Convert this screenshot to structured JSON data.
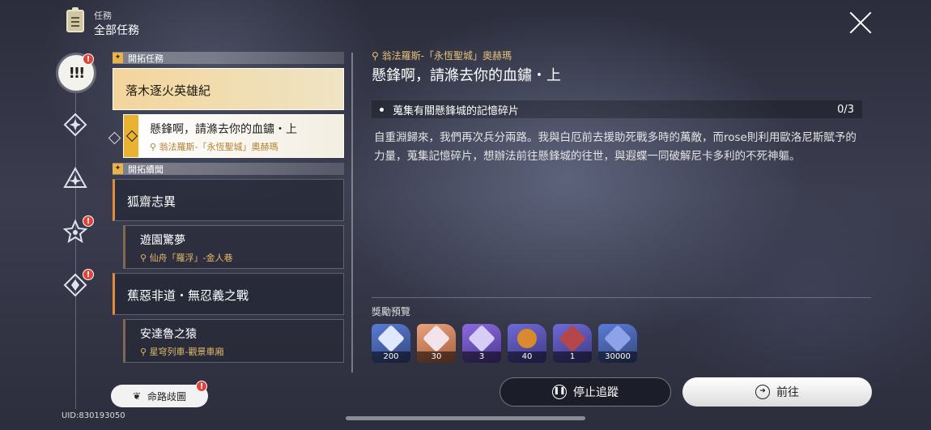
{
  "header": {
    "subtitle": "任務",
    "title": "全部任務"
  },
  "sections": [
    {
      "label": "開拓任務"
    },
    {
      "label": "開拓續聞"
    }
  ],
  "quests": {
    "q1": {
      "title": "落木逐火英雄紀"
    },
    "q1s": {
      "title": "懸鋒啊，請滌去你的血鏽・上",
      "location": "翁法羅斯-「永恆聖城」奧赫瑪"
    },
    "q2": {
      "title": "狐齋志異"
    },
    "q2s": {
      "title": "遊園驚夢",
      "location": "仙舟「羅浮」-金人巷"
    },
    "q3": {
      "title": "蕉惡非道・無忍義之戰"
    },
    "q3s": {
      "title": "安達魯之猿",
      "location": "星穹列車-觀景車廂"
    }
  },
  "detail": {
    "location": "翁法羅斯-「永恆聖城」奧赫瑪",
    "title": "懸鋒啊，請滌去你的血鏽・上",
    "objective": "蒐集有關懸鋒城的記憶碎片",
    "progress": "0/3",
    "description": "自重淵歸來，我們再次兵分兩路。我與白厄前去援助死戰多時的萬敵，而rose則利用歐洛尼斯賦予的力量，蒐集記憶碎片，想辦法前往懸鋒城的往世，與遐蝶一同破解尼卡多利的不死神軀。"
  },
  "rewards": {
    "label": "獎勵預覽",
    "items": [
      {
        "qty": "200",
        "icon": "stellar-jade-icon",
        "color": "#5a7bd6"
      },
      {
        "qty": "30",
        "icon": "crystal-icon",
        "color": "#e08a60"
      },
      {
        "qty": "3",
        "icon": "purple-material-icon",
        "color": "#7a5ad8"
      },
      {
        "qty": "40",
        "icon": "bottle-icon",
        "color": "#6a66d0"
      },
      {
        "qty": "1",
        "icon": "book-icon",
        "color": "#6a66d0"
      },
      {
        "qty": "30000",
        "icon": "credit-icon",
        "color": "#5a7bd6"
      }
    ]
  },
  "buttons": {
    "stop": "停止追蹤",
    "go": "前往",
    "fate": "命路歧圖"
  },
  "uid": "UID:830193050",
  "badge": "!"
}
